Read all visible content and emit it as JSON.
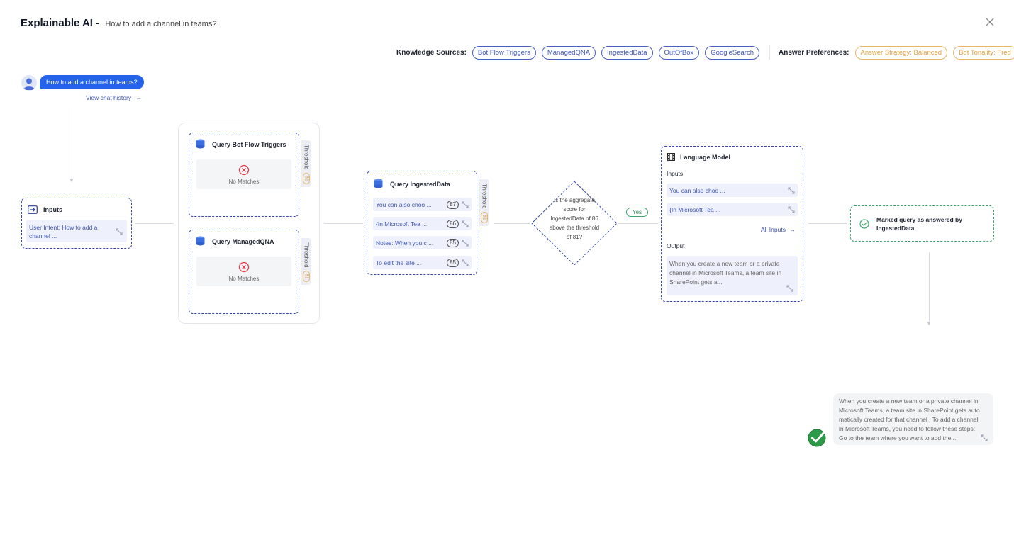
{
  "header": {
    "title": "Explainable AI -",
    "query": "How to add a channel in teams?"
  },
  "knowledge": {
    "label": "Knowledge Sources:",
    "sources": [
      "Bot Flow Triggers",
      "ManagedQNA",
      "IngestedData",
      "OutOfBox",
      "GoogleSearch"
    ]
  },
  "preferences": {
    "label": "Answer Preferences:",
    "items": [
      "Answer Strategy: Balanced",
      "Bot Tonality: Fred"
    ]
  },
  "chat": {
    "message": "How to add a channel in teams?",
    "history_link": "View chat history"
  },
  "inputs": {
    "title": "Inputs",
    "value": "User Intent: How to add a channel ..."
  },
  "bot_flow": {
    "title": "Query Bot Flow Triggers",
    "no_matches": "No Matches",
    "threshold_label": "Threshold",
    "threshold_value": "81"
  },
  "managed_qna": {
    "title": "Query ManagedQNA",
    "no_matches": "No Matches",
    "threshold_label": "Threshold",
    "threshold_value": "81"
  },
  "ingested": {
    "title": "Query IngestedData",
    "threshold_label": "Threshold",
    "threshold_value": "81",
    "results": [
      {
        "text": "You can also choo ...",
        "score": "87"
      },
      {
        "text": "{In Microsoft Tea ...",
        "score": "86"
      },
      {
        "text": "Notes: When you c ...",
        "score": "85"
      },
      {
        "text": "To edit the site ...",
        "score": "85"
      }
    ]
  },
  "decision": {
    "question": "Is the aggregate score for IngestedData of 86 above the threshold of 81?",
    "yes_label": "Yes"
  },
  "language_model": {
    "title": "Language Model",
    "inputs_label": "Inputs",
    "inputs": [
      "You can also choo ...",
      "{In Microsoft Tea ..."
    ],
    "all_inputs": "All Inputs",
    "output_label": "Output",
    "output": "When you create a new team or a private channel in Microsoft Teams, a team site in SharePoint gets a..."
  },
  "result": {
    "text": "Marked query as answered by IngestedData"
  },
  "answer": {
    "text": "When you create a new team or a private channel in Microsoft Teams, a team site in SharePoint gets auto matically created for that channel . To add a channel in Microsoft Teams, you need to follow these steps: Go to the team where you want to add the ..."
  },
  "colors": {
    "primary": "#2563eb",
    "accent_blue": "#3f57b5",
    "accent_orange": "#e0a34b",
    "success": "#3aa66a",
    "error": "#e23a4b"
  }
}
